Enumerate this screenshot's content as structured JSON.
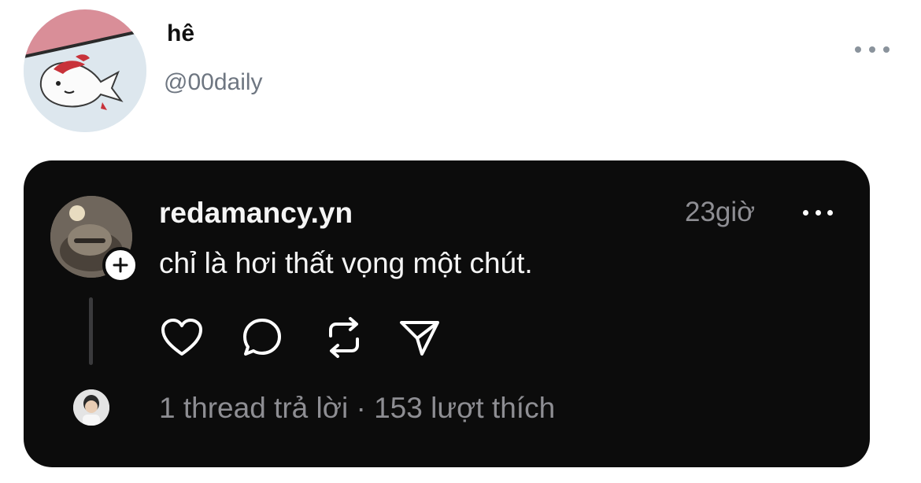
{
  "header": {
    "name": "hê",
    "handle": "@00daily",
    "avatar_icon": "koi-fish-cartoon-avatar",
    "more_icon": "more-horizontal-icon"
  },
  "post": {
    "username": "redamancy.yn",
    "time": "23giờ",
    "text": "chỉ là hơi thất vọng một chút.",
    "stats": {
      "replies": "1 thread trả lời",
      "separator": "·",
      "likes": "153 lượt thích"
    },
    "actions": [
      "heart-icon",
      "comment-icon",
      "repost-icon",
      "share-icon"
    ]
  },
  "colors": {
    "card_background": "#0c0c0c",
    "text_primary": "#f5f5f5",
    "text_secondary": "#8e8e93",
    "handle_gray": "#6e7681"
  }
}
